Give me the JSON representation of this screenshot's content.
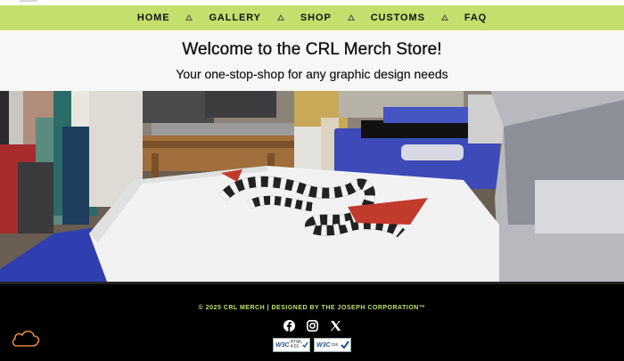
{
  "theme": {
    "accent": "#c3e06c",
    "footer_bg": "#000000",
    "cloud_color": "#e0873a"
  },
  "nav": {
    "items": [
      {
        "label": "HOME"
      },
      {
        "label": "GALLERY"
      },
      {
        "label": "SHOP"
      },
      {
        "label": "CUSTOMS"
      },
      {
        "label": "FAQ"
      }
    ],
    "separator_icon": "triangle-icon"
  },
  "hero": {
    "title": "Welcome to the CRL Merch Store!",
    "subtitle": "Your one-stop-shop for any graphic design needs"
  },
  "banner": {
    "image": "t-shirt printing press with snake graphic"
  },
  "footer": {
    "copyright": "© 2025 CRL MERCH  |  DESIGNED BY THE JOSEPH CORPORATION™",
    "socials": [
      {
        "icon": "facebook-icon"
      },
      {
        "icon": "instagram-icon"
      },
      {
        "icon": "x-icon"
      }
    ],
    "badges": [
      {
        "w3c": "W3C",
        "line1": "HTML",
        "line2": "4.01"
      },
      {
        "w3c": "W3C",
        "line1": "css",
        "line2": ""
      }
    ],
    "cloud_icon": "cloud-icon"
  }
}
